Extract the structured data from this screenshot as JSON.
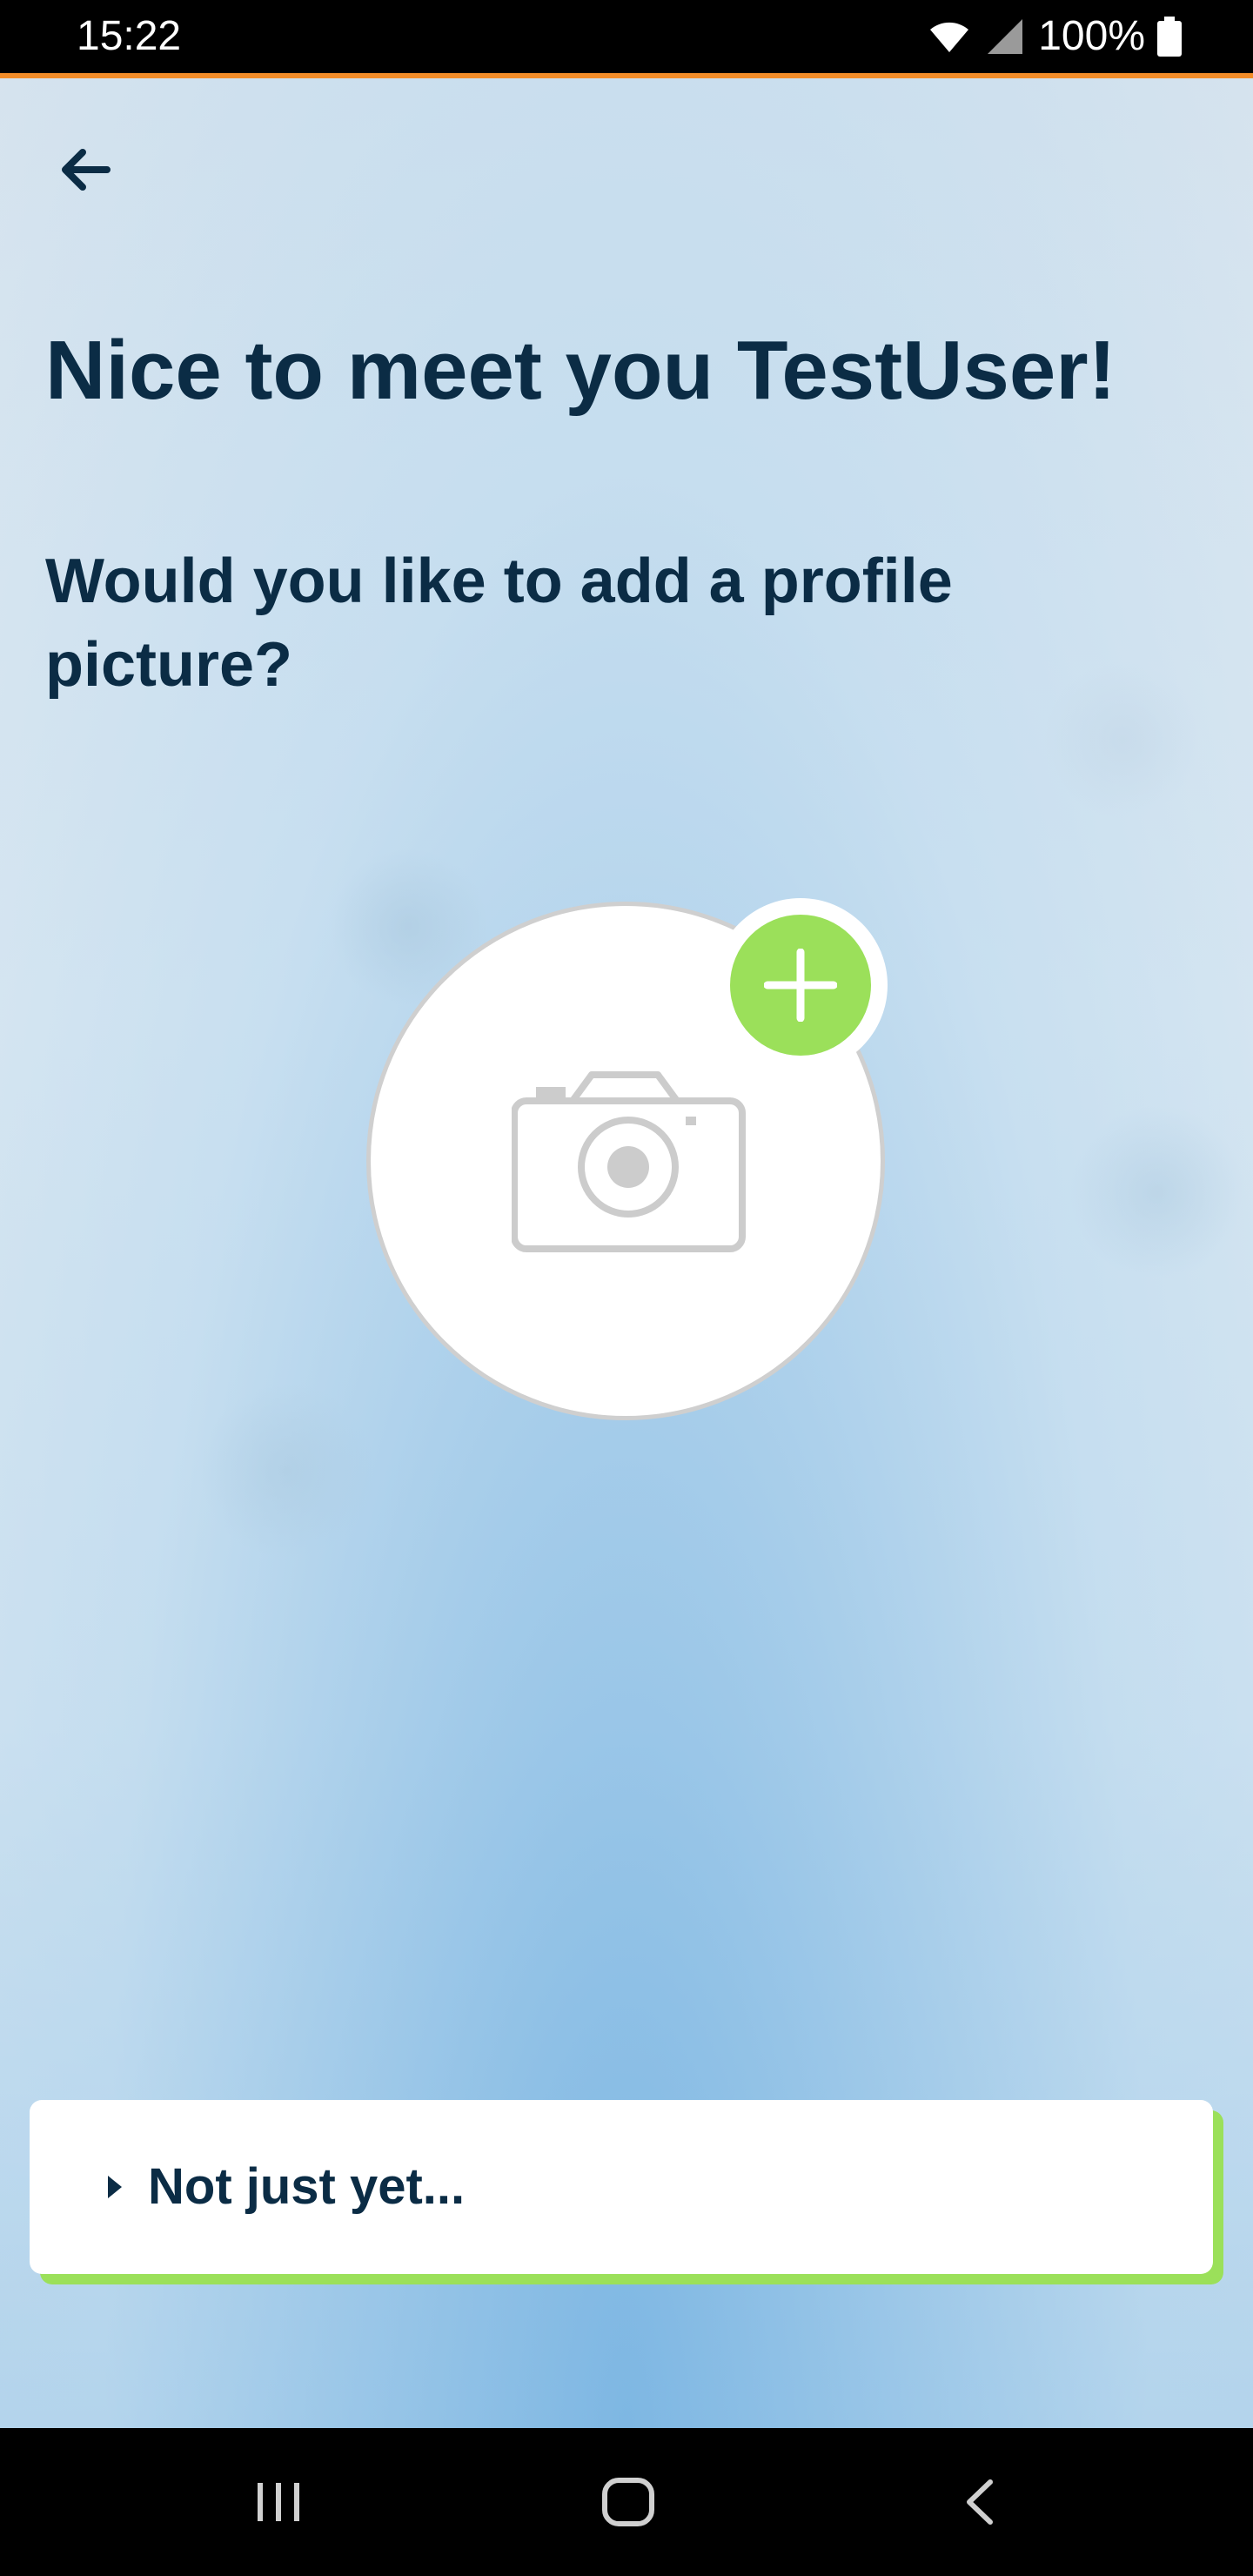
{
  "status_bar": {
    "time": "15:22",
    "battery": "100%",
    "icons": [
      "wifi-icon",
      "signal-icon",
      "battery-icon"
    ]
  },
  "header": {
    "back_icon": "arrow-left-icon"
  },
  "main": {
    "title": "Nice to meet you TestUser!",
    "subtitle": "Would you like to add a profile picture?",
    "avatar_icon": "camera-icon",
    "add_icon": "plus-icon"
  },
  "skip": {
    "label": "Not just yet...",
    "icon": "caret-right-icon"
  },
  "nav": {
    "icons": [
      "recent-apps-icon",
      "home-icon",
      "back-icon"
    ]
  },
  "colors": {
    "primary_text": "#0b2c45",
    "accent_green": "#9be05a",
    "status_accent": "#f28c28"
  }
}
